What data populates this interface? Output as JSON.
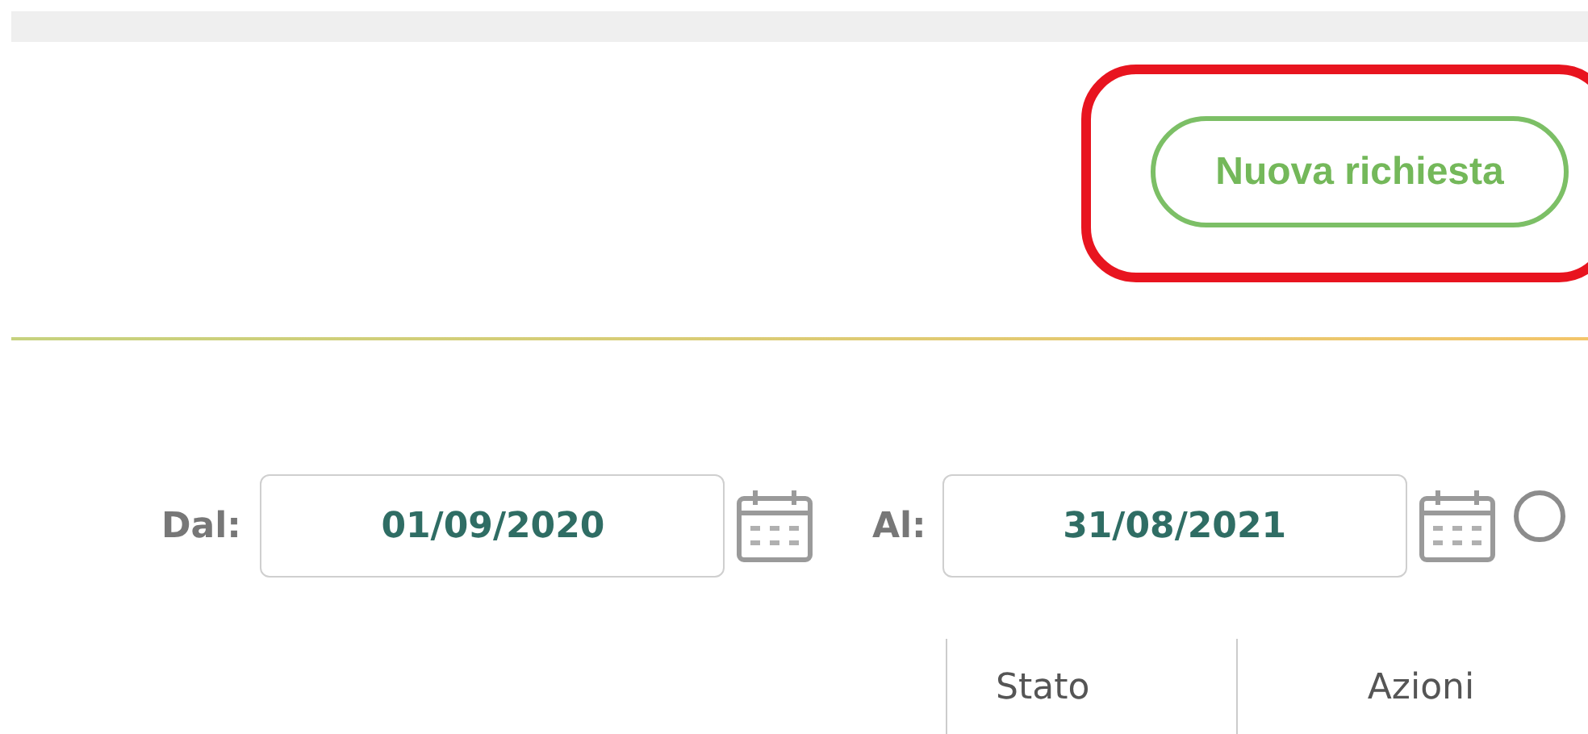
{
  "toolbar": {
    "new_request_button": "Nuova richiesta",
    "highlighted": true
  },
  "date_filter": {
    "from_label": "Dal:",
    "from_value": "01/09/2020",
    "to_label": "Al:",
    "to_value": "31/08/2021",
    "radio": {
      "selected": false
    }
  },
  "table": {
    "columns": [
      {
        "label": "Stato"
      },
      {
        "label": "Azioni"
      }
    ]
  }
}
